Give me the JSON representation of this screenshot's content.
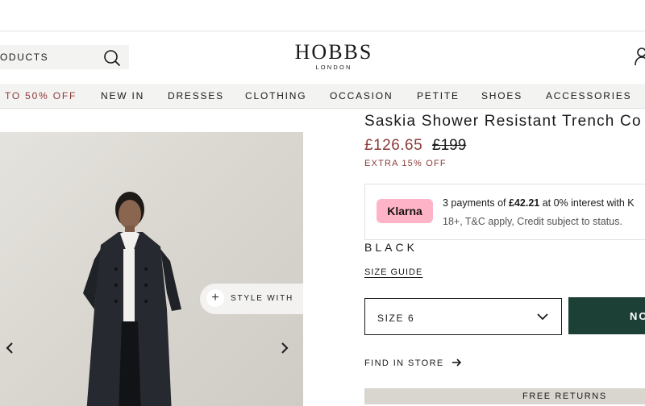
{
  "header": {
    "search_text": "ODUCTS",
    "logo_main": "HOBBS",
    "logo_sub": "LONDON"
  },
  "nav": {
    "items": [
      "TO 50% OFF",
      "NEW IN",
      "DRESSES",
      "CLOTHING",
      "OCCASION",
      "PETITE",
      "SHOES",
      "ACCESSORIES"
    ]
  },
  "gallery": {
    "style_with_label": "STYLE WITH"
  },
  "product": {
    "title": "Saskia Shower Resistant Trench Co",
    "price_now": "£126.65",
    "price_was": "£199",
    "extra_off": "EXTRA 15% OFF",
    "color": "BLACK",
    "size_guide": "SIZE GUIDE",
    "size_label": "SIZE  6",
    "add_button": "NO",
    "find_in_store": "FIND IN STORE",
    "returns_banner": "FREE RETURNS"
  },
  "klarna": {
    "badge": "Klarna",
    "line1_prefix": "3 payments of ",
    "line1_amount": "£42.21",
    "line1_suffix": " at 0% interest with K",
    "line2": "18+, T&C apply, Credit subject to status."
  },
  "colors": {
    "sale_red": "#8b3a3a",
    "button_green": "#1c3f36",
    "klarna_pink": "#ffb3c7",
    "nav_bg": "#f3f3f1"
  }
}
